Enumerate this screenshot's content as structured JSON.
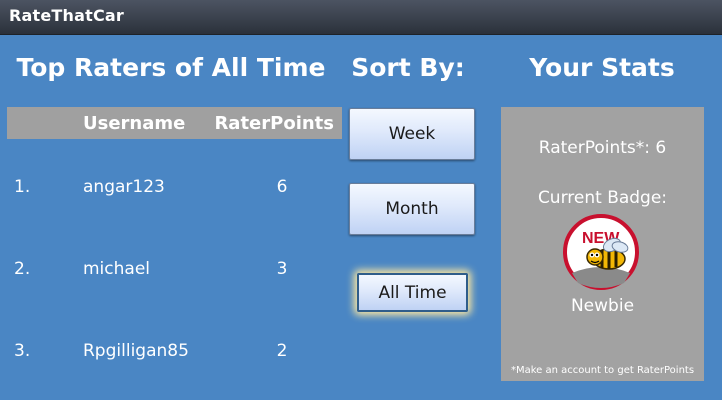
{
  "app": {
    "title": "RateThatCar"
  },
  "leaderboard": {
    "heading": "Top Raters of All Time",
    "columns": {
      "username": "Username",
      "points": "RaterPoints"
    },
    "rows": [
      {
        "rank": "1.",
        "username": "angar123",
        "points": "6"
      },
      {
        "rank": "2.",
        "username": "michael",
        "points": "3"
      },
      {
        "rank": "3.",
        "username": "Rpgilligan85",
        "points": "2"
      }
    ]
  },
  "sort": {
    "heading": "Sort By:",
    "options": [
      "Week",
      "Month",
      "All Time"
    ],
    "selected": "All Time"
  },
  "stats": {
    "heading": "Your Stats",
    "points_text": "RaterPoints*: 6",
    "badge_label": "Current Badge:",
    "badge_name": "Newbie",
    "badge_icon": "new-bee-badge-icon",
    "badge_icon_text": "NEW",
    "footnote": "*Make an account to get RaterPoints"
  }
}
